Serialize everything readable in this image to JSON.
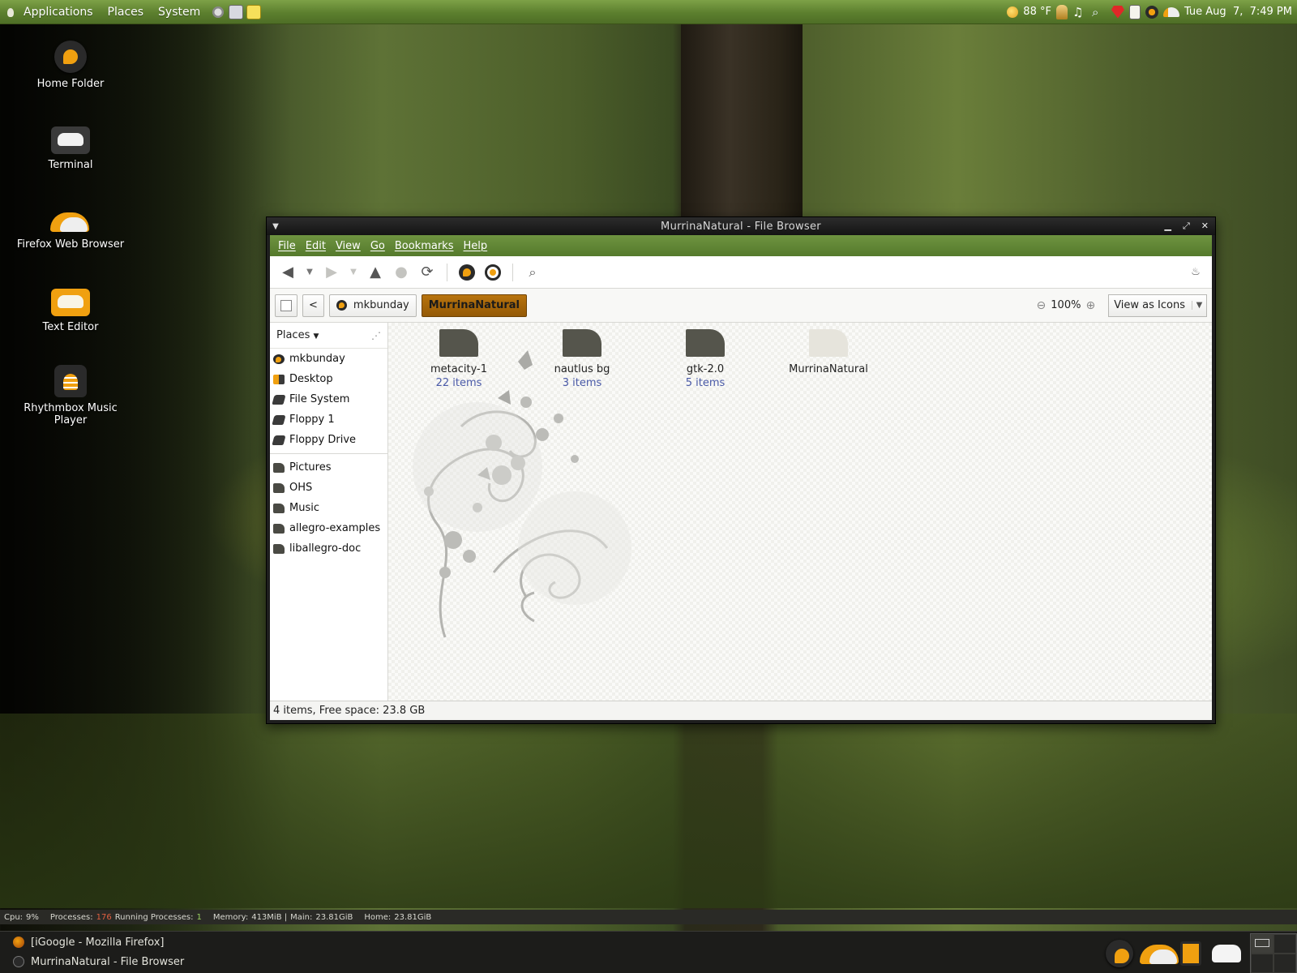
{
  "top_panel": {
    "menus": [
      "Applications",
      "Places",
      "System"
    ],
    "weather": "88 °F",
    "clock": "Tue Aug  7,  7:49 PM"
  },
  "desktop_icons": [
    {
      "label": "Home Folder",
      "icon": "home-icon"
    },
    {
      "label": "Terminal",
      "icon": "terminal-icon"
    },
    {
      "label": "Firefox Web Browser",
      "icon": "firefox-icon"
    },
    {
      "label": "Text Editor",
      "icon": "text-editor-icon"
    },
    {
      "label": "Rhythmbox Music Player",
      "icon": "rhythmbox-icon"
    }
  ],
  "window": {
    "title": "MurrinaNatural - File Browser",
    "menubar": [
      "File",
      "Edit",
      "View",
      "Go",
      "Bookmarks",
      "Help"
    ],
    "location": {
      "back_label": "<",
      "crumbs": [
        "mkbunday",
        "MurrinaNatural"
      ],
      "zoom": "100%",
      "view_mode": "View as Icons"
    },
    "sidebar": {
      "header": "Places",
      "devices": [
        {
          "label": "mkbunday",
          "icon": "home"
        },
        {
          "label": "Desktop",
          "icon": "desktop"
        },
        {
          "label": "File System",
          "icon": "drive"
        },
        {
          "label": "Floppy 1",
          "icon": "drive"
        },
        {
          "label": "Floppy Drive",
          "icon": "drive"
        }
      ],
      "bookmarks": [
        {
          "label": "Pictures"
        },
        {
          "label": "OHS"
        },
        {
          "label": "Music"
        },
        {
          "label": "allegro-examples"
        },
        {
          "label": "liballegro-doc"
        }
      ]
    },
    "files": [
      {
        "name": "metacity-1",
        "count": "22 items"
      },
      {
        "name": "nautlus bg",
        "count": "3 items"
      },
      {
        "name": "gtk-2.0",
        "count": "5 items"
      },
      {
        "name": "MurrinaNatural",
        "count": ""
      }
    ],
    "status": "4 items, Free space: 23.8 GB"
  },
  "sysinfo": {
    "cpu_label": "Cpu:",
    "cpu": "9%",
    "processes_label": "Processes:",
    "processes": "176",
    "running_label": "Running Processes:",
    "running": "1",
    "memory_label": "Memory:",
    "memory": "413MiB |",
    "main_label": "Main:",
    "main": "23.81GiB",
    "home_label": "Home:",
    "home": "23.81GiB"
  },
  "taskbar": {
    "tasks": [
      "[iGoogle - Mozilla Firefox]",
      "MurrinaNatural - File Browser"
    ]
  }
}
